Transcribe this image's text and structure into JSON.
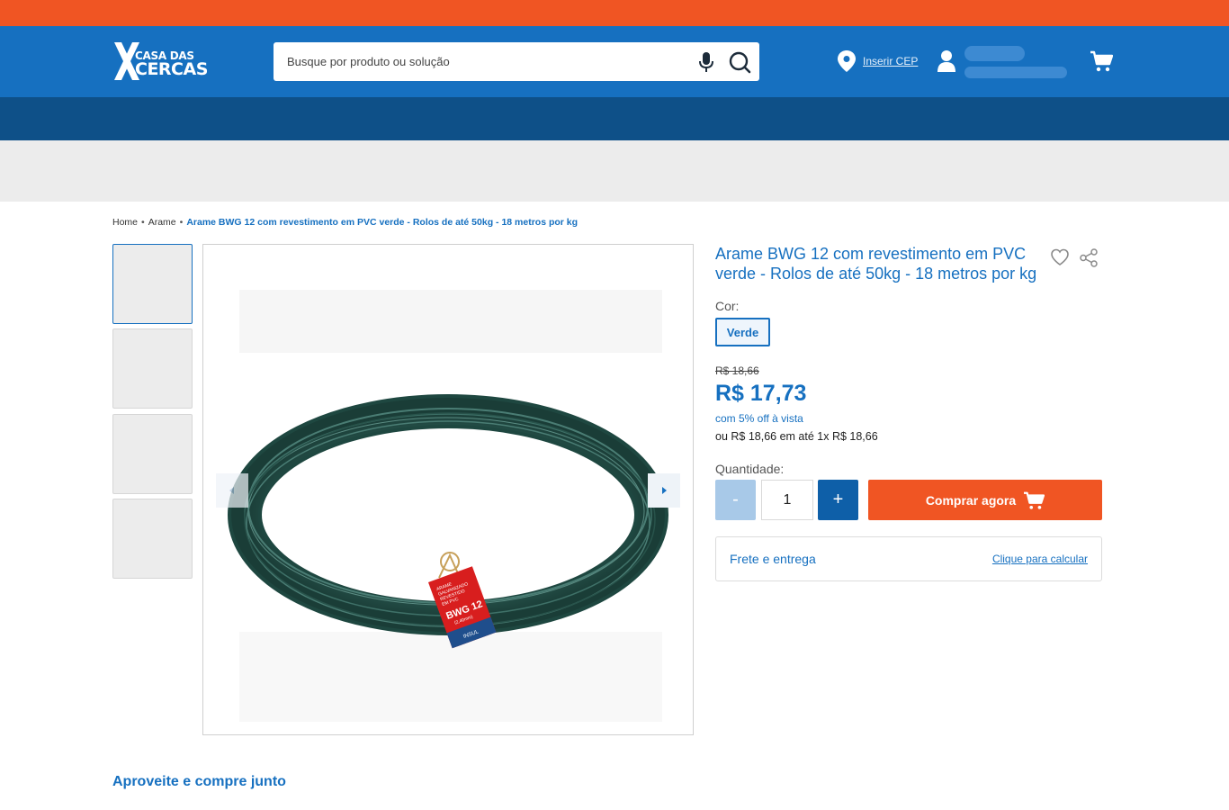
{
  "brand": {
    "logo_line1": "CASA DAS",
    "logo_line2": "CERCAS",
    "colors": {
      "primary": "#1670c0",
      "dark": "#0e5088",
      "accent": "#f05523"
    }
  },
  "header": {
    "search": {
      "placeholder": "Busque por produto ou solução"
    },
    "icons": [
      "mic-icon",
      "search-icon",
      "pin-icon",
      "user-icon",
      "cart-icon"
    ],
    "cep_link": "Inserir CEP"
  },
  "breadcrumb": {
    "items": [
      "Home",
      "Arame",
      "Arame BWG 12 com revestimento em PVC verde - Rolos de até 50kg - 18 metros por kg"
    ],
    "separator": "•"
  },
  "gallery": {
    "thumbnail_count": 4,
    "active_thumbnail": 1
  },
  "product": {
    "title": "Arame BWG 12 com revestimento em PVC verde - Rolos de até 50kg - 18 metros por kg",
    "color_label": "Cor:",
    "color_option": "Verde",
    "old_price": "R$ 18,66",
    "price": "R$ 17,73",
    "discount_text": "com 5% off à vista",
    "installments_text": "ou R$ 18,66 em até 1x R$ 18,66",
    "quantity_label": "Quantidade:",
    "quantity_value": "1",
    "minus_label": "-",
    "plus_label": "+",
    "buy_label": "Comprar agora",
    "shipping_label": "Frete e entrega",
    "shipping_link": "Clique para calcular"
  },
  "tag_image": {
    "line1": "ARAME",
    "line2": "GALVANIZADO",
    "line3": "REVESTIDO",
    "line4": "EM PVC",
    "code": "BWG 12",
    "size": "(2,40mm)",
    "maker": "INSUL"
  },
  "sections": {
    "buy_together": "Aproveite e compre junto"
  }
}
